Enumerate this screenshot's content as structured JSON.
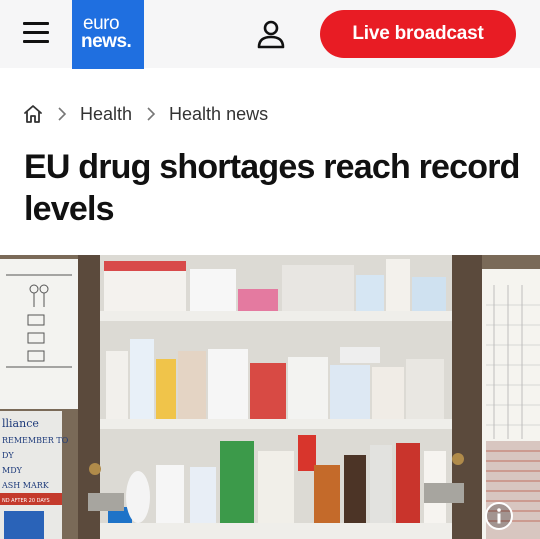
{
  "header": {
    "logo_line1": "euro",
    "logo_line2": "news.",
    "live_label": "Live broadcast",
    "brand_color": "#1f6fe0",
    "live_color": "#e81c24"
  },
  "breadcrumb": {
    "items": [
      "Health",
      "Health news"
    ]
  },
  "article": {
    "title": "EU drug shortages reach record levels"
  },
  "hero": {
    "image_text": {
      "left_poster": [
        "lliance",
        "REMEMBER TO",
        "DY",
        "MDY",
        "ASH MARK",
        "ND AFTER 20 DAYS"
      ]
    }
  }
}
